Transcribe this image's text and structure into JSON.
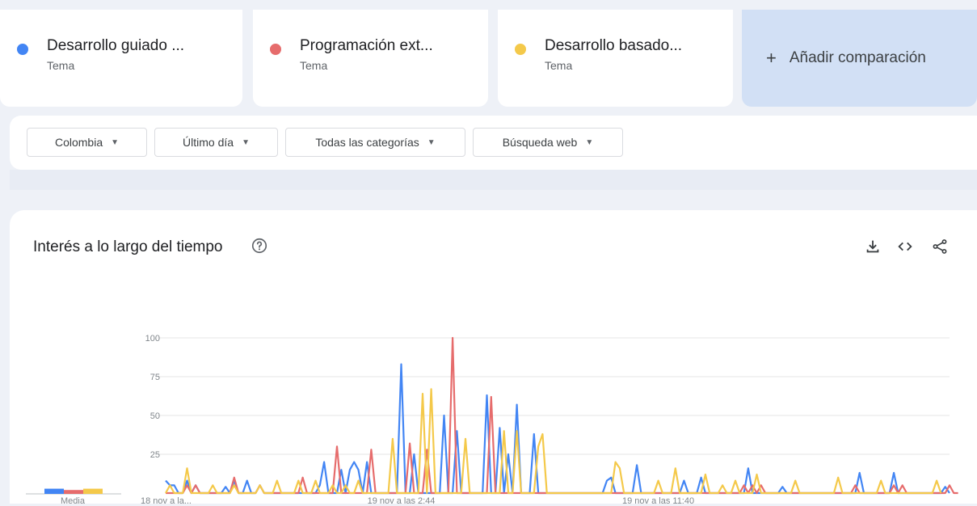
{
  "terms": [
    {
      "name": "Desarrollo guiado ...",
      "type": "Tema",
      "color": "#4285f4"
    },
    {
      "name": "Programación ext...",
      "type": "Tema",
      "color": "#e66c6c"
    },
    {
      "name": "Desarrollo basado...",
      "type": "Tema",
      "color": "#f4c94a"
    }
  ],
  "add_comparison": {
    "label": "Añadir comparación",
    "icon": "plus-icon"
  },
  "filters": [
    {
      "label": "Colombia"
    },
    {
      "label": "Último día"
    },
    {
      "label": "Todas las categorías"
    },
    {
      "label": "Búsqueda web"
    }
  ],
  "panel": {
    "title": "Interés a lo largo del tiempo",
    "icons": [
      "help-icon",
      "download-icon",
      "embed-icon",
      "share-icon"
    ]
  },
  "media": {
    "label": "Media",
    "values": [
      4,
      3,
      4
    ]
  },
  "chart_data": {
    "type": "line",
    "ylim": [
      0,
      100
    ],
    "y_ticks": [
      "25",
      "50",
      "75",
      "100"
    ],
    "x_tick_labels": [
      "18 nov a la...",
      "19 nov a las 2:44",
      "19 nov a las 11:40"
    ],
    "x_tick_index": [
      0,
      55,
      115
    ],
    "grid": true,
    "series": [
      {
        "color": "#4285f4",
        "values": [
          8,
          5,
          5,
          0,
          0,
          8,
          0,
          5,
          0,
          0,
          0,
          0,
          0,
          0,
          4,
          0,
          8,
          0,
          0,
          8,
          0,
          0,
          5,
          0,
          0,
          0,
          0,
          0,
          0,
          0,
          0,
          0,
          0,
          0,
          0,
          0,
          5,
          20,
          0,
          0,
          0,
          15,
          0,
          15,
          20,
          15,
          0,
          20,
          0,
          0,
          0,
          0,
          0,
          0,
          0,
          83,
          0,
          0,
          25,
          0,
          0,
          0,
          0,
          0,
          0,
          50,
          0,
          0,
          40,
          0,
          0,
          0,
          0,
          0,
          0,
          63,
          0,
          0,
          42,
          0,
          25,
          0,
          57,
          0,
          0,
          0,
          38,
          0,
          0,
          0,
          0,
          0,
          0,
          0,
          0,
          0,
          0,
          0,
          0,
          0,
          0,
          0,
          0,
          8,
          10,
          0,
          0,
          0,
          0,
          0,
          18,
          0,
          0,
          0,
          0,
          0,
          0,
          0,
          0,
          0,
          0,
          8,
          0,
          0,
          0,
          10,
          0,
          0,
          0,
          0,
          0,
          0,
          0,
          0,
          0,
          0,
          16,
          0,
          0,
          0,
          0,
          0,
          0,
          0,
          4,
          0,
          0,
          0,
          0,
          0,
          0,
          0,
          0,
          0,
          0,
          0,
          0,
          0,
          0,
          0,
          0,
          0,
          13,
          0,
          0,
          0,
          0,
          0,
          0,
          0,
          13,
          0,
          0,
          0,
          0,
          0,
          0,
          0,
          0,
          0,
          0,
          0,
          4,
          0
        ]
      },
      {
        "color": "#e66c6c",
        "values": [
          0,
          0,
          0,
          0,
          0,
          5,
          0,
          5,
          0,
          0,
          0,
          0,
          0,
          0,
          0,
          0,
          10,
          0,
          0,
          0,
          0,
          0,
          5,
          0,
          0,
          0,
          0,
          0,
          0,
          0,
          0,
          0,
          10,
          0,
          0,
          0,
          0,
          0,
          0,
          0,
          30,
          0,
          0,
          0,
          0,
          0,
          0,
          0,
          28,
          0,
          0,
          0,
          0,
          0,
          0,
          0,
          0,
          32,
          0,
          0,
          0,
          28,
          0,
          0,
          0,
          0,
          0,
          100,
          0,
          0,
          0,
          0,
          0,
          0,
          0,
          0,
          62,
          0,
          0,
          0,
          0,
          0,
          0,
          0,
          0,
          0,
          0,
          0,
          0,
          0,
          0,
          0,
          0,
          0,
          0,
          0,
          0,
          0,
          0,
          0,
          0,
          0,
          0,
          0,
          0,
          0,
          0,
          0,
          0,
          0,
          0,
          0,
          0,
          0,
          0,
          0,
          0,
          0,
          0,
          0,
          0,
          0,
          0,
          0,
          0,
          0,
          0,
          0,
          0,
          0,
          0,
          0,
          0,
          0,
          0,
          5,
          0,
          5,
          0,
          5,
          0,
          0,
          0,
          0,
          0,
          0,
          0,
          0,
          0,
          0,
          0,
          0,
          0,
          0,
          0,
          0,
          0,
          0,
          0,
          0,
          0,
          5,
          0,
          0,
          0,
          0,
          0,
          0,
          0,
          0,
          5,
          0,
          5,
          0,
          0,
          0,
          0,
          0,
          0,
          0,
          0,
          0,
          0,
          5,
          0,
          0
        ]
      },
      {
        "color": "#f4c94a",
        "values": [
          0,
          5,
          0,
          0,
          0,
          16,
          0,
          0,
          0,
          0,
          0,
          5,
          0,
          0,
          0,
          0,
          5,
          0,
          0,
          0,
          0,
          0,
          5,
          0,
          0,
          0,
          8,
          0,
          0,
          0,
          0,
          8,
          0,
          0,
          0,
          8,
          0,
          0,
          0,
          5,
          0,
          0,
          5,
          0,
          0,
          8,
          0,
          0,
          0,
          0,
          0,
          0,
          0,
          35,
          0,
          0,
          0,
          0,
          0,
          0,
          64,
          0,
          67,
          0,
          0,
          0,
          0,
          0,
          0,
          0,
          35,
          0,
          0,
          0,
          0,
          0,
          0,
          0,
          0,
          40,
          0,
          0,
          40,
          0,
          0,
          0,
          0,
          30,
          38,
          0,
          0,
          0,
          0,
          0,
          0,
          0,
          0,
          0,
          0,
          0,
          0,
          0,
          0,
          0,
          0,
          20,
          16,
          0,
          0,
          0,
          0,
          0,
          0,
          0,
          0,
          8,
          0,
          0,
          0,
          16,
          0,
          0,
          0,
          0,
          0,
          0,
          12,
          0,
          0,
          0,
          5,
          0,
          0,
          8,
          0,
          0,
          0,
          0,
          12,
          0,
          0,
          0,
          0,
          0,
          0,
          0,
          0,
          8,
          0,
          0,
          0,
          0,
          0,
          0,
          0,
          0,
          0,
          10,
          0,
          0,
          0,
          0,
          0,
          0,
          0,
          0,
          0,
          8,
          0,
          0,
          0,
          0,
          0,
          0,
          0,
          0,
          0,
          0,
          0,
          0,
          8,
          0
        ]
      }
    ]
  }
}
